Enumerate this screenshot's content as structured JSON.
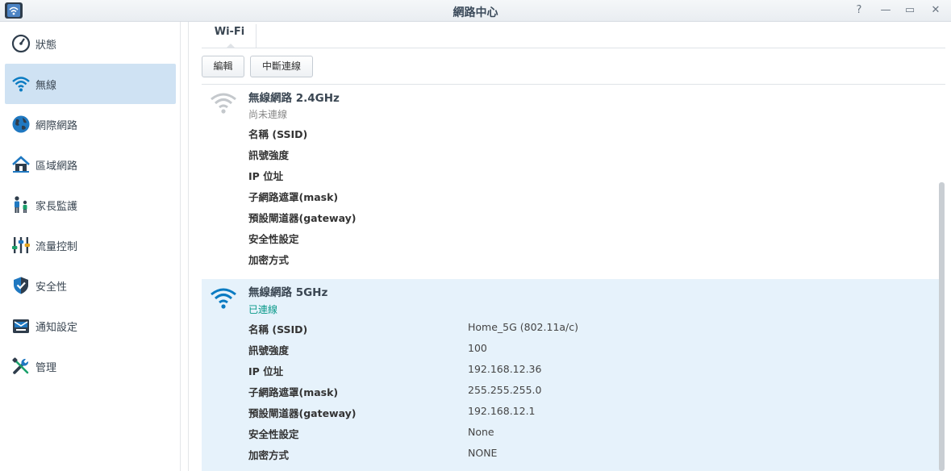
{
  "window": {
    "title": "網路中心",
    "controls": [
      "?",
      "—",
      "▭",
      "✕"
    ]
  },
  "sidebar": {
    "items": [
      {
        "label": "狀態",
        "icon": "gauge-icon"
      },
      {
        "label": "無線",
        "icon": "wifi-icon",
        "active": true
      },
      {
        "label": "網際網路",
        "icon": "globe-icon"
      },
      {
        "label": "區域網路",
        "icon": "home-icon"
      },
      {
        "label": "家長監護",
        "icon": "family-icon"
      },
      {
        "label": "流量控制",
        "icon": "sliders-icon"
      },
      {
        "label": "安全性",
        "icon": "shield-icon"
      },
      {
        "label": "通知設定",
        "icon": "mail-icon"
      },
      {
        "label": "管理",
        "icon": "tools-icon"
      }
    ]
  },
  "tabs": [
    {
      "label": "Wi-Fi",
      "active": true
    }
  ],
  "toolbar": {
    "edit_label": "編輯",
    "disconnect_label": "中斷連線"
  },
  "networks": [
    {
      "title": "無線網路 2.4GHz",
      "status": "尚未連線",
      "connected": false,
      "rows": [
        {
          "label": "名稱 (SSID)",
          "value": ""
        },
        {
          "label": "訊號強度",
          "value": ""
        },
        {
          "label": "IP 位址",
          "value": ""
        },
        {
          "label": "子網路遮罩(mask)",
          "value": ""
        },
        {
          "label": "預設閘道器(gateway)",
          "value": ""
        },
        {
          "label": "安全性設定",
          "value": ""
        },
        {
          "label": "加密方式",
          "value": ""
        }
      ]
    },
    {
      "title": "無線網路 5GHz",
      "status": "已連線",
      "connected": true,
      "rows": [
        {
          "label": "名稱 (SSID)",
          "value": "Home_5G (802.11a/c)"
        },
        {
          "label": "訊號強度",
          "value": "100"
        },
        {
          "label": "IP 位址",
          "value": "192.168.12.36"
        },
        {
          "label": "子網路遮罩(mask)",
          "value": "255.255.255.0"
        },
        {
          "label": "預設閘道器(gateway)",
          "value": "192.168.12.1"
        },
        {
          "label": "安全性設定",
          "value": "None"
        },
        {
          "label": "加密方式",
          "value": "NONE"
        }
      ]
    }
  ],
  "colors": {
    "accent": "#0a7bc2",
    "active_nav": "#cfe2f3",
    "connected_bg": "#e6f2fb",
    "connected_text": "#0a9a8a",
    "disconnected_text": "#888888"
  }
}
